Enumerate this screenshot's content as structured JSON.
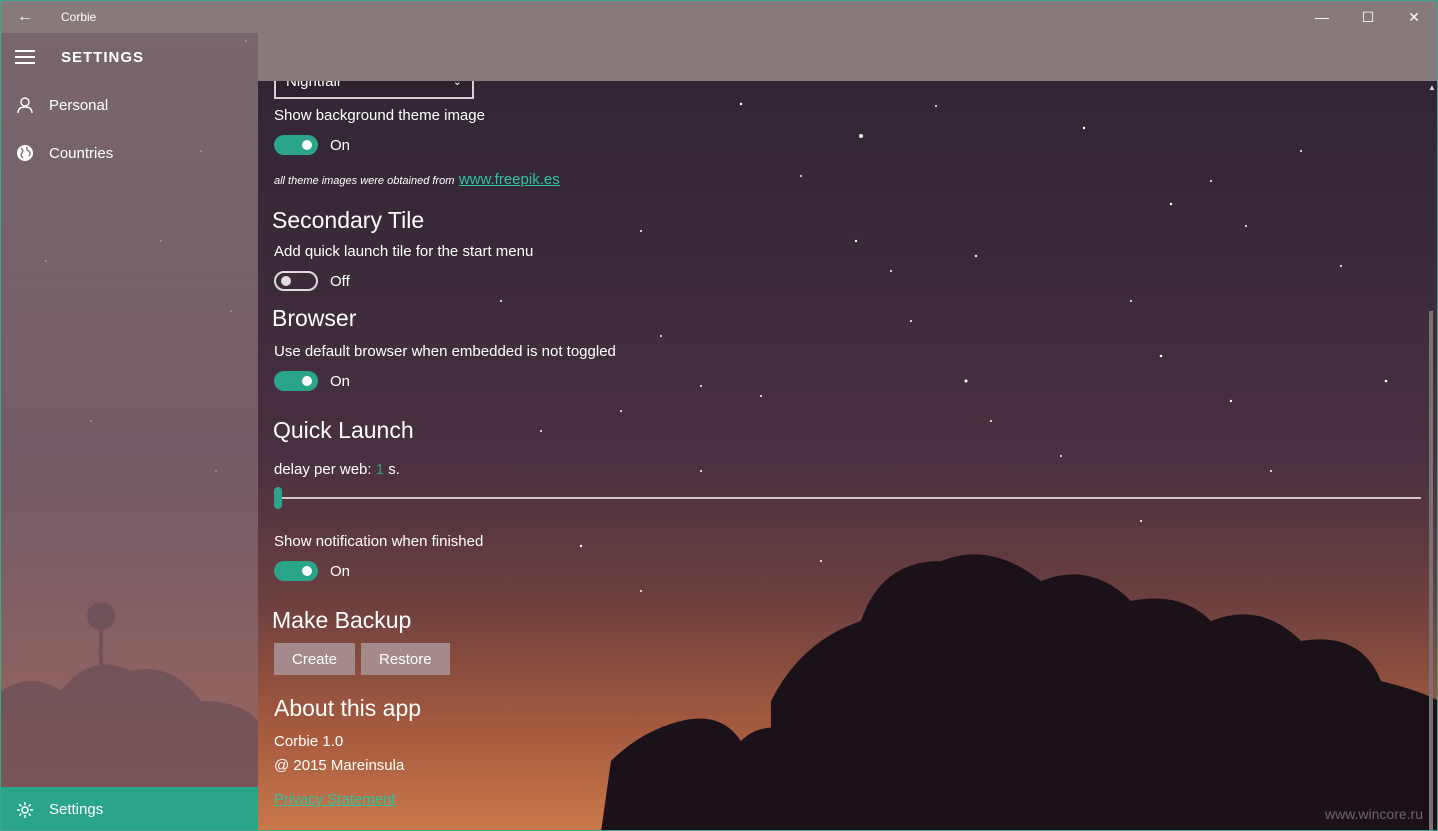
{
  "window": {
    "title": "Corbie",
    "back_icon": "back-arrow-icon",
    "controls": {
      "minimize": "—",
      "maximize": "☐",
      "close": "✕"
    }
  },
  "sidebar": {
    "title": "SETTINGS",
    "items": [
      {
        "label": "Personal",
        "icon": "person-icon"
      },
      {
        "label": "Countries",
        "icon": "globe-icon"
      }
    ],
    "bottom": {
      "label": "Settings",
      "icon": "gear-icon"
    }
  },
  "settings": {
    "theme_dropdown_value": "Nightfall",
    "background": {
      "label": "Show background theme image",
      "state": "On",
      "credit_text": "all theme images were obtained from",
      "credit_link": "www.freepik.es"
    },
    "secondary_tile": {
      "heading": "Secondary Tile",
      "label": "Add quick launch tile for the start menu",
      "state": "Off"
    },
    "browser": {
      "heading": "Browser",
      "label": "Use default browser when embedded is not toggled",
      "state": "On"
    },
    "quick_launch": {
      "heading": "Quick Launch",
      "delay_label": "delay per web:",
      "delay_value": "1",
      "delay_unit": "s.",
      "notify_label": "Show notification when finished",
      "notify_state": "On"
    },
    "backup": {
      "heading": "Make Backup",
      "create": "Create",
      "restore": "Restore"
    },
    "about": {
      "heading": "About this app",
      "version": "Corbie 1.0",
      "copyright": "@ 2015 Mareinsula",
      "privacy": "Privacy Statement"
    }
  },
  "watermark": "www.wincore.ru",
  "colors": {
    "accent": "#2aa58a",
    "titlebar": "#877a7a"
  }
}
